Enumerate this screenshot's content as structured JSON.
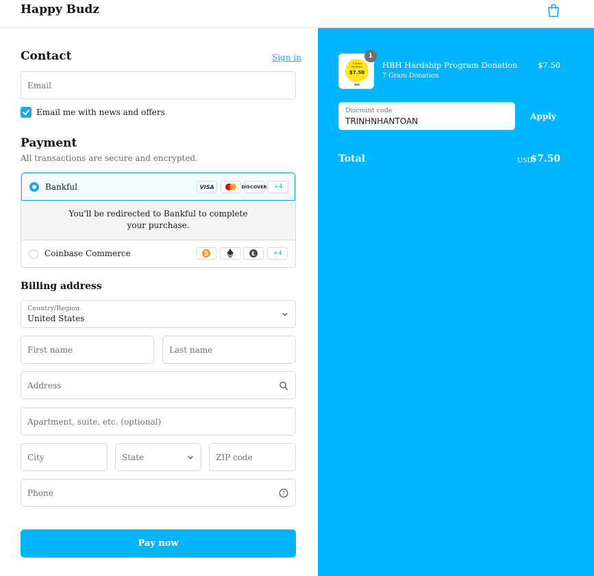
{
  "store": {
    "name": "Happy Budz",
    "cart_icon": "shopping-bag-icon"
  },
  "contact": {
    "heading": "Contact",
    "sign_in_label": "Sign in",
    "email_placeholder": "Email",
    "newsletter_label": "Email me with news and offers",
    "newsletter_checked": true
  },
  "payment": {
    "heading": "Payment",
    "subtitle": "All transactions are secure and encrypted.",
    "options": [
      {
        "label": "Bankful",
        "selected": true,
        "logos": [
          "VISA",
          "mastercard",
          "DISCOVER"
        ],
        "more": "+4"
      },
      {
        "label": "Coinbase Commerce",
        "selected": false,
        "logos": [
          "bitcoin",
          "ethereum",
          "litecoin"
        ],
        "more": "+4"
      }
    ],
    "redirect_text": "You'll be redirected to Bankful to complete your purchase."
  },
  "billing": {
    "heading": "Billing address",
    "country_label": "Country/Region",
    "country_value": "United States",
    "first_name": "First name",
    "last_name": "Last name",
    "address": "Address",
    "apartment": "Apartment, suite, etc. (optional)",
    "city": "City",
    "state": "State",
    "zip": "ZIP code",
    "phone": "Phone"
  },
  "pay_button": "Pay now",
  "summary": {
    "item": {
      "name": "HBH Hardship Program Donation",
      "variant": "7 Gram Donation",
      "price": "$7.50",
      "quantity": "1",
      "thumb_text_top": "7 Gram Donation",
      "thumb_text_price": "$7.50"
    },
    "discount_label": "Discount code",
    "discount_value": "TRINHNHANTOAN",
    "apply_label": "Apply",
    "total_label": "Total",
    "currency": "USD",
    "total_value": "$7.50"
  },
  "colors": {
    "accent": "#00b4ff",
    "link": "#19a8e0"
  }
}
